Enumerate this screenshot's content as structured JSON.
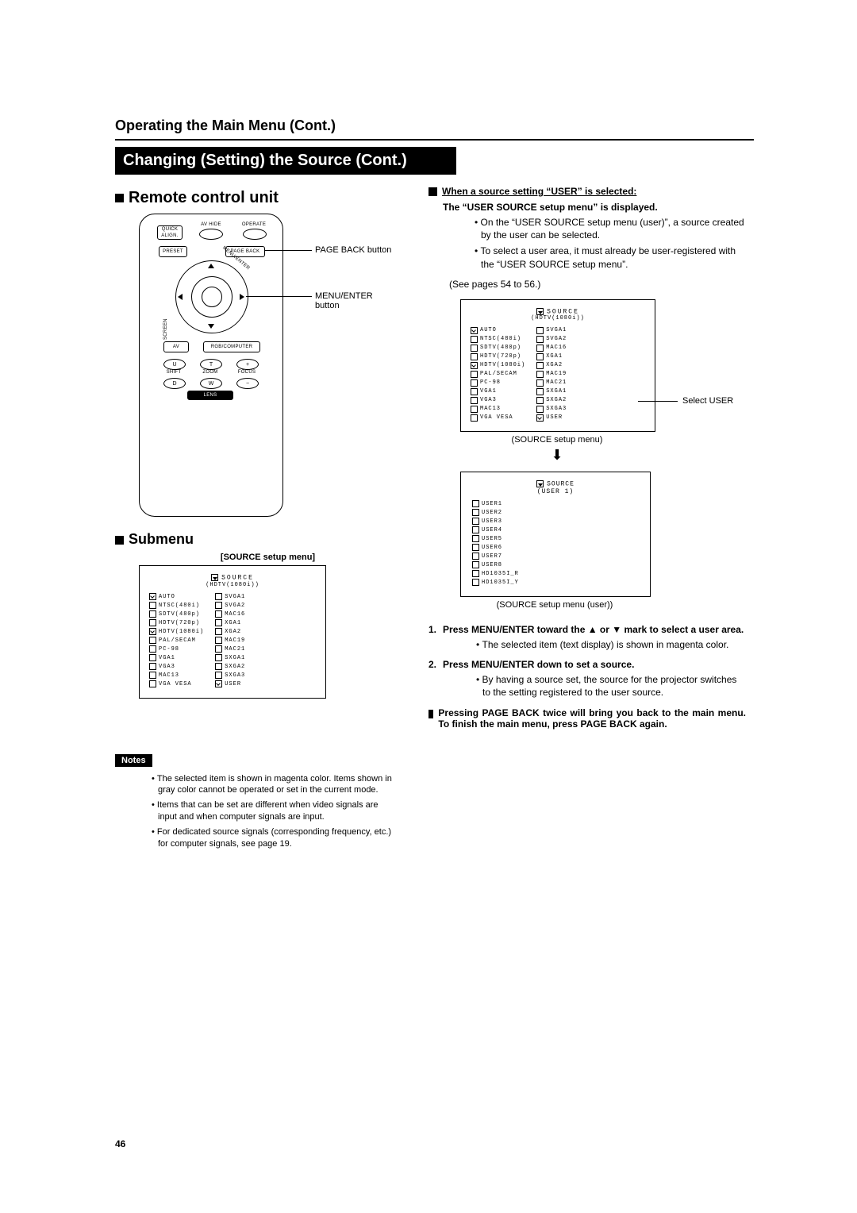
{
  "header": {
    "section_title": "Operating the Main Menu (Cont.)",
    "banner": "Changing (Setting) the Source (Cont.)"
  },
  "left": {
    "remote_heading": "Remote control unit",
    "remote_buttons": {
      "quick_align": "QUICK\nALIGN.",
      "av_hide": "AV HIDE",
      "operate": "OPERATE",
      "preset": "PRESET",
      "page_back_btn": "PAGE BACK",
      "menu_enter_ring": "MENU/ENTER",
      "screen_label": "SCREEN",
      "av": "AV",
      "rgb_computer": "RGB/COMPUTER",
      "u": "U",
      "t": "T",
      "plus": "+",
      "shift": "SHIFT",
      "zoom": "ZOOM",
      "focus": "FOCUS",
      "d": "D",
      "w": "W",
      "minus": "−",
      "lens": "LENS"
    },
    "callout_page_back": "PAGE BACK button",
    "callout_menu_enter": "MENU/ENTER button",
    "submenu_heading": "Submenu",
    "source_menu_label": "[SOURCE setup menu]",
    "source_menu": {
      "title": "SOURCE",
      "subtitle": "(HDTV(1080i))",
      "left_items": [
        "AUTO",
        "NTSC(480i)",
        "SDTV(480p)",
        "HDTV(720p)",
        "HDTV(1080i)",
        "PAL/SECAM",
        "PC-98",
        "VGA1",
        "VGA3",
        "MAC13",
        "VGA VESA"
      ],
      "right_items": [
        "SVGA1",
        "SVGA2",
        "MAC16",
        "XGA1",
        "XGA2",
        "MAC19",
        "MAC21",
        "SXGA1",
        "SXGA2",
        "SXGA3",
        "USER"
      ]
    },
    "notes_label": "Notes",
    "notes": [
      "The selected item is shown in magenta color. Items shown in gray color cannot be operated or set in the current mode.",
      "Items that can be set are different when video signals are input and when computer signals are input.",
      "For dedicated source signals (corresponding frequency, etc.) for computer signals, see page 19."
    ]
  },
  "right": {
    "when_selected": "When a source setting “USER” is selected:",
    "user_displayed": "The “USER SOURCE setup menu” is displayed.",
    "bullets1": [
      "On the “USER SOURCE setup menu (user)”, a source created by the user can be selected.",
      "To select a user area, it must already be user-registered with the “USER SOURCE setup menu”."
    ],
    "see_pages": "(See pages 54 to 56.)",
    "select_user_callout": "Select USER",
    "menu1_caption": "(SOURCE setup menu)",
    "menu2_caption": "(SOURCE setup menu (user))",
    "user_menu": {
      "title": "SOURCE",
      "subtitle": "(USER 1)",
      "items": [
        "USER1",
        "USER2",
        "USER3",
        "USER4",
        "USER5",
        "USER6",
        "USER7",
        "USER8",
        "HD1035I_R",
        "HD1035I_Y"
      ]
    },
    "steps": [
      {
        "num": "1.",
        "head": "Press MENU/ENTER toward the ▲ or ▼ mark to select a user area.",
        "sub": [
          "The selected item (text display) is shown in magenta color."
        ]
      },
      {
        "num": "2.",
        "head": "Press MENU/ENTER down to set a source.",
        "sub": [
          "By having a source set, the source for the projector switches to the setting registered to the user source."
        ]
      }
    ],
    "pageback_final": "Pressing PAGE BACK twice will bring you back to the main menu. To finish the main menu, press PAGE BACK again."
  },
  "page_number": "46"
}
